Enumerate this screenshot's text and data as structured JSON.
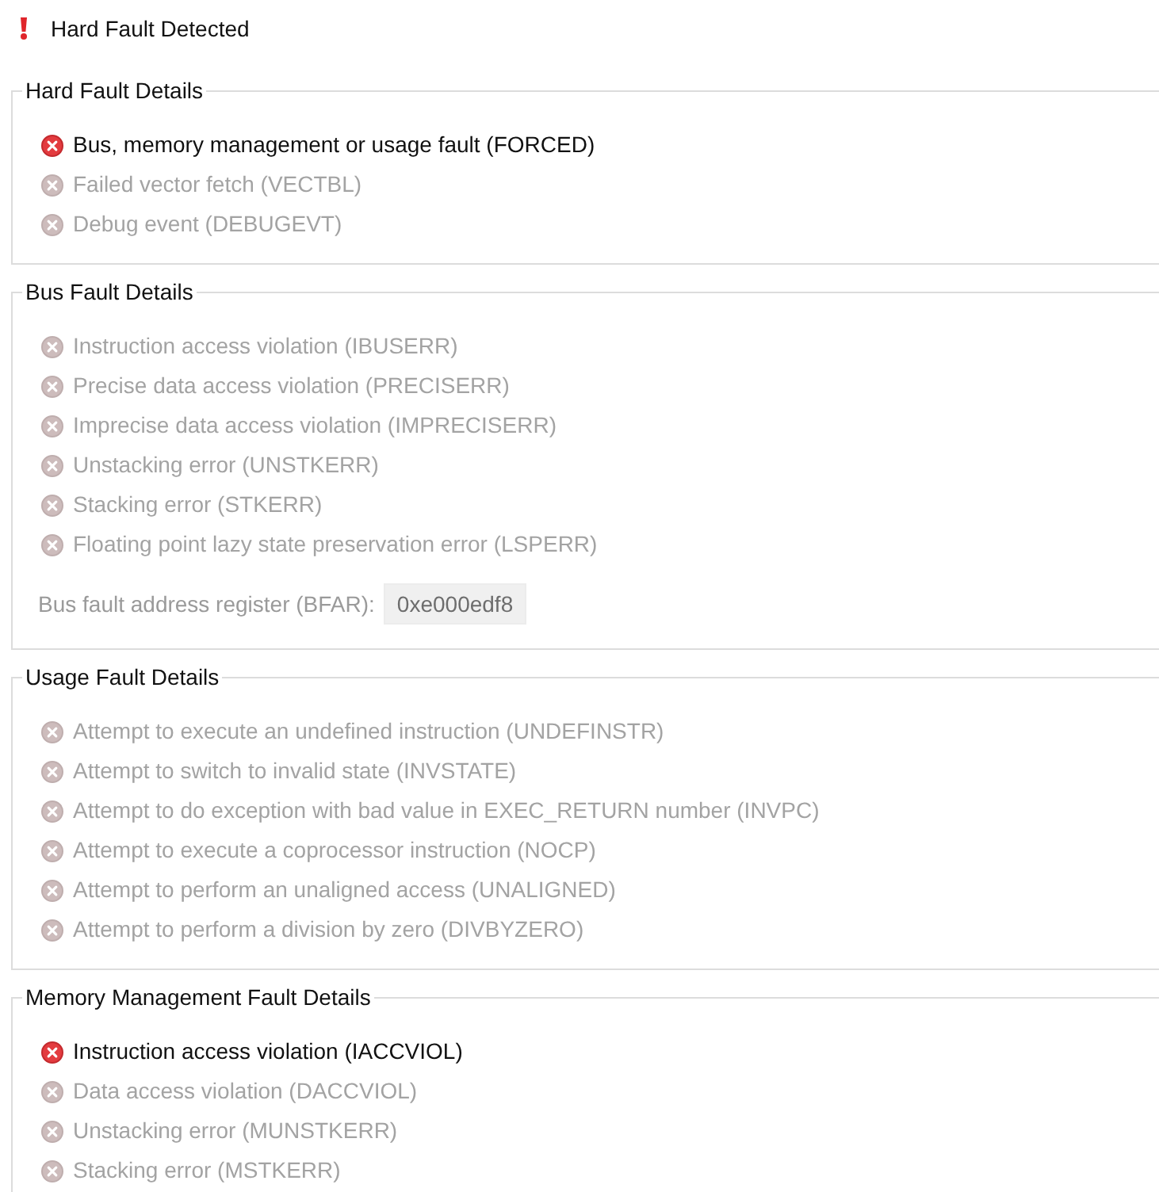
{
  "header": {
    "title": "Hard Fault Detected"
  },
  "groups": [
    {
      "title": "Hard Fault Details",
      "flags": [
        {
          "label": "Bus, memory management or usage fault (FORCED)",
          "set": true
        },
        {
          "label": "Failed vector fetch (VECTBL)",
          "set": false
        },
        {
          "label": "Debug event (DEBUGEVT)",
          "set": false
        }
      ]
    },
    {
      "title": "Bus Fault Details",
      "flags": [
        {
          "label": "Instruction access violation (IBUSERR)",
          "set": false
        },
        {
          "label": "Precise data access violation (PRECISERR)",
          "set": false
        },
        {
          "label": "Imprecise data access violation (IMPRECISERR)",
          "set": false
        },
        {
          "label": "Unstacking error (UNSTKERR)",
          "set": false
        },
        {
          "label": "Stacking error (STKERR)",
          "set": false
        },
        {
          "label": "Floating point lazy state preservation error (LSPERR)",
          "set": false
        }
      ],
      "register": {
        "label": "Bus fault address register (BFAR):",
        "value": "0xe000edf8",
        "disabled": true
      }
    },
    {
      "title": "Usage Fault Details",
      "flags": [
        {
          "label": "Attempt to execute an undefined instruction (UNDEFINSTR)",
          "set": false
        },
        {
          "label": "Attempt to switch to invalid state (INVSTATE)",
          "set": false
        },
        {
          "label": "Attempt to do exception with bad value in EXEC_RETURN number (INVPC)",
          "set": false
        },
        {
          "label": "Attempt to execute a coprocessor instruction (NOCP)",
          "set": false
        },
        {
          "label": "Attempt to perform an unaligned access (UNALIGNED)",
          "set": false
        },
        {
          "label": "Attempt to perform a division by zero (DIVBYZERO)",
          "set": false
        }
      ]
    },
    {
      "title": "Memory Management Fault Details",
      "flags": [
        {
          "label": "Instruction access violation (IACCVIOL)",
          "set": true
        },
        {
          "label": "Data access violation (DACCVIOL)",
          "set": false
        },
        {
          "label": "Unstacking error (MUNSTKERR)",
          "set": false
        },
        {
          "label": "Stacking error (MSTKERR)",
          "set": false
        }
      ]
    }
  ]
}
